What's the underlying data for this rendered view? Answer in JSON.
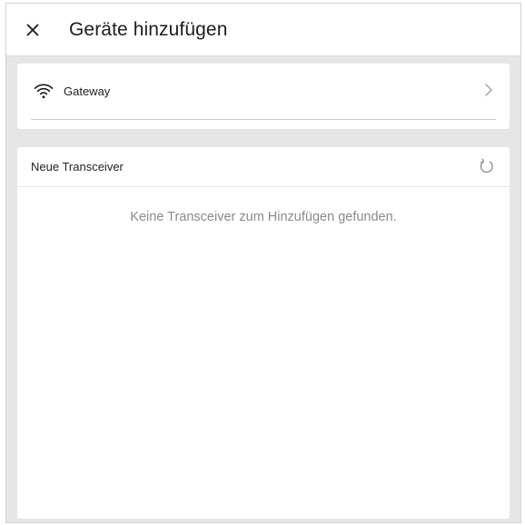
{
  "header": {
    "title": "Geräte hinzufügen",
    "close_icon": "close-icon"
  },
  "gateway": {
    "label": "Gateway",
    "icon": "wifi-icon",
    "chevron_icon": "chevron-right-icon"
  },
  "transceivers": {
    "title": "Neue Transceiver",
    "refresh_icon": "refresh-icon",
    "empty_message": "Keine Transceiver zum Hinzufügen gefunden."
  },
  "colors": {
    "background": "#e6e6e6",
    "card": "#ffffff",
    "muted_text": "#8a8a8a"
  }
}
